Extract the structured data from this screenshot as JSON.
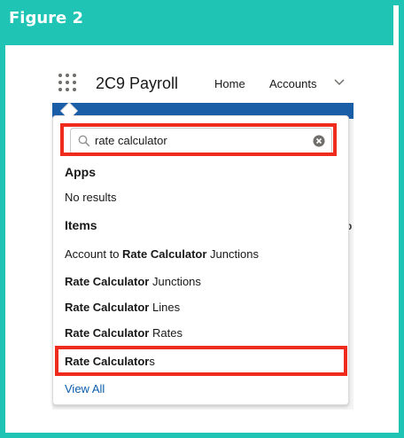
{
  "figure": {
    "label": "Figure 2"
  },
  "header": {
    "app_name": "2C9 Payroll",
    "nav": [
      "Home",
      "Accounts"
    ]
  },
  "search": {
    "value": "rate calculator"
  },
  "apps_section": {
    "title": "Apps",
    "empty_text": "No results"
  },
  "items_section": {
    "title": "Items",
    "results": [
      {
        "prefix": "Account to ",
        "bold": "Rate Calculator",
        "suffix": " Junctions"
      },
      {
        "prefix": "",
        "bold": "Rate Calculator",
        "suffix": " Junctions"
      },
      {
        "prefix": "",
        "bold": "Rate Calculator",
        "suffix": " Lines"
      },
      {
        "prefix": "",
        "bold": "Rate Calculator",
        "suffix": " Rates"
      },
      {
        "prefix": "",
        "bold": "Rate Calculator",
        "suffix": "s"
      }
    ]
  },
  "view_all": "View All",
  "background_fragment": "p",
  "colors": {
    "figure_accent": "#1fc4b4",
    "highlight": "#ef2b1e",
    "brand_band": "#1b5ea8",
    "link": "#0b5cab"
  }
}
